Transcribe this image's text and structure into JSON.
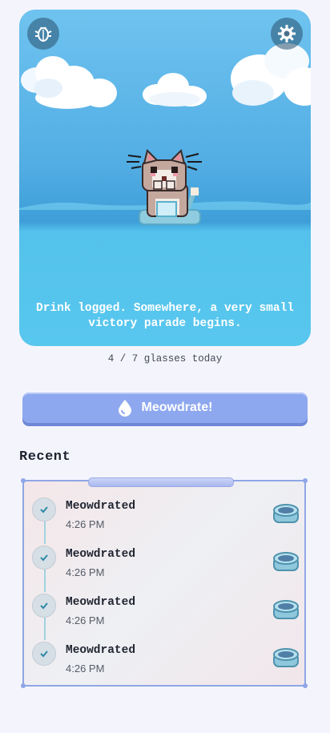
{
  "scene": {
    "message": "Drink logged. Somewhere, a very small victory parade begins.",
    "debug_icon": "bug-icon",
    "settings_icon": "gear-icon"
  },
  "progress": {
    "text": "4 / 7 glasses today",
    "current": 4,
    "goal": 7
  },
  "hydrate_button": {
    "label": "Meowdrate!",
    "icon": "water-drop-icon"
  },
  "recent": {
    "title": "Recent",
    "entries": [
      {
        "label": "Meowdrated",
        "time": "4:26 PM"
      },
      {
        "label": "Meowdrated",
        "time": "4:26 PM"
      },
      {
        "label": "Meowdrated",
        "time": "4:26 PM"
      },
      {
        "label": "Meowdrated",
        "time": "4:26 PM"
      }
    ]
  },
  "colors": {
    "sky": "#6fc3ef",
    "water": "#58c7ee",
    "button": "#8ea8ef",
    "panel_border": "#8fa6e6",
    "page_bg": "#f4f5fc"
  }
}
